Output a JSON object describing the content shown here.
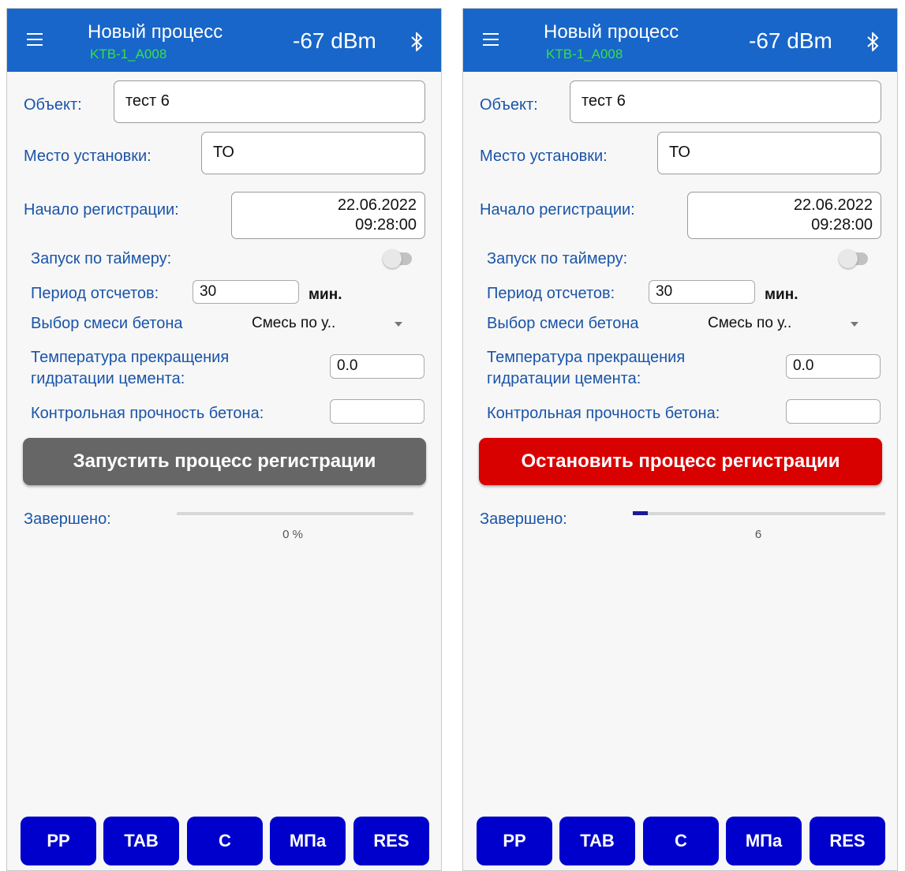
{
  "colors": {
    "appbar": "#1866c9",
    "device_id": "#36e04a",
    "start_button": "#666666",
    "stop_button": "#d90000",
    "bottom_buttons": "#0000cc"
  },
  "left": {
    "appbar": {
      "menu_icon": "hamburger-menu-icon",
      "title": "Новый процесс",
      "device_id": "KTB-1_A008",
      "signal": "-67 dBm",
      "bluetooth_icon": "bluetooth-icon"
    },
    "form": {
      "object_label": "Объект:",
      "object_value": "тест 6",
      "location_label": "Место установки:",
      "location_value": "ТО",
      "start_label": "Начало регистрации:",
      "start_date": "22.06.2022",
      "start_time": "09:28:00",
      "timer_label": "Запуск по таймеру:",
      "timer_on": false,
      "period_label": "Период отсчетов:",
      "period_value": "30",
      "period_unit": "мин.",
      "mix_label": "Выбор смеси бетона",
      "mix_value": "Смесь по у..",
      "temp_label_1": "Температура прекращения",
      "temp_label_2": "гидратации цемента:",
      "temp_value": "0.0",
      "strength_label": "Контрольная прочность бетона:",
      "strength_value": ""
    },
    "action_button": "Запустить процесс регистрации",
    "progress": {
      "label": "Завершено:",
      "text": "0 %",
      "fraction": 0
    },
    "bottom_buttons": [
      "PP",
      "TAB",
      "C",
      "МПа",
      "RES"
    ]
  },
  "right": {
    "appbar": {
      "menu_icon": "hamburger-menu-icon",
      "title": "Новый процесс",
      "device_id": "KTB-1_A008",
      "signal": "-67 dBm",
      "bluetooth_icon": "bluetooth-icon"
    },
    "form": {
      "object_label": "Объект:",
      "object_value": "тест 6",
      "location_label": "Место установки:",
      "location_value": "ТО",
      "start_label": "Начало регистрации:",
      "start_date": "22.06.2022",
      "start_time": "09:28:00",
      "timer_label": "Запуск по таймеру:",
      "timer_on": false,
      "period_label": "Период отсчетов:",
      "period_value": "30",
      "period_unit": "мин.",
      "mix_label": "Выбор смеси бетона",
      "mix_value": "Смесь по у..",
      "temp_label_1": "Температура прекращения",
      "temp_label_2": "гидратации цемента:",
      "temp_value": "0.0",
      "strength_label": "Контрольная прочность бетона:",
      "strength_value": ""
    },
    "action_button": "Остановить процесс регистрации",
    "progress": {
      "label": "Завершено:",
      "text": "6",
      "fraction": 0.06
    },
    "bottom_buttons": [
      "PP",
      "TAB",
      "C",
      "МПа",
      "RES"
    ]
  }
}
